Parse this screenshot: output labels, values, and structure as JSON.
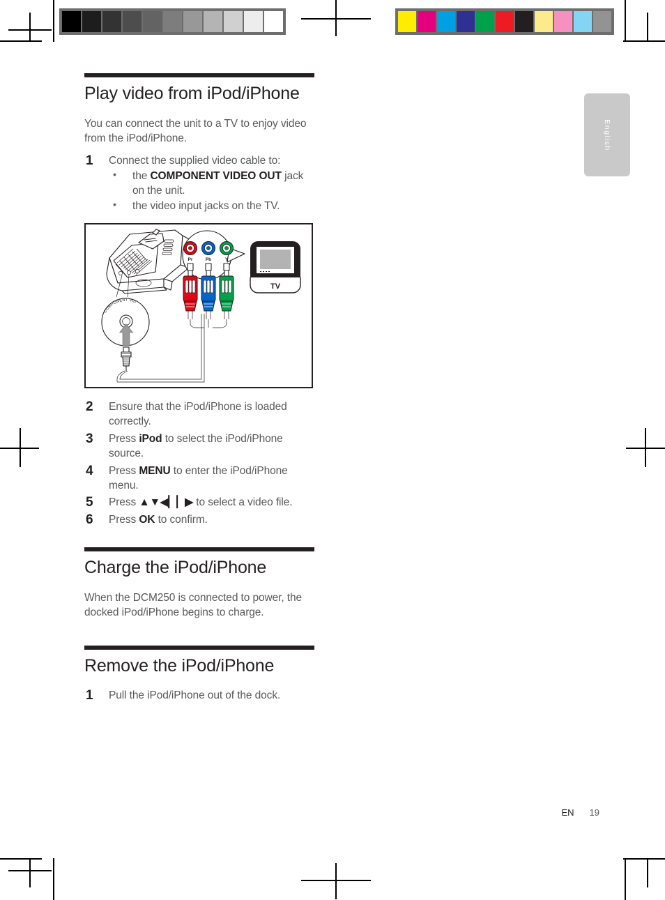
{
  "document": {
    "language_tab": "English",
    "footer": {
      "language_code": "EN",
      "page_number": "19"
    }
  },
  "calibration": {
    "grayscale_label": "grayscale-calibration-bar",
    "grayscale_swatches": [
      "#000000",
      "#1d1d1d",
      "#333333",
      "#4d4d4d",
      "#636363",
      "#7d7d7d",
      "#989898",
      "#b4b4b4",
      "#d0d0d0",
      "#ededed",
      "#ffffff"
    ],
    "color_label": "color-calibration-bar",
    "color_swatches": [
      "#ffed00",
      "#e5007d",
      "#00a0e3",
      "#2e3192",
      "#00a14b",
      "#ed1c24",
      "#231f20",
      "#fbeb8d",
      "#f690c0",
      "#84d5f3",
      "#939393"
    ]
  },
  "sections": [
    {
      "id": "play-video",
      "title": "Play video from iPod/iPhone",
      "intro": "You can connect the unit to a TV to enjoy video from the iPod/iPhone.",
      "steps": [
        {
          "num": "1",
          "text": "Connect the supplied video cable to:",
          "bullets": [
            {
              "prefix": "the ",
              "bold": "COMPONENT VIDEO OUT",
              "suffix": " jack on the unit."
            },
            {
              "prefix": "the video input jacks on the TV.",
              "bold": "",
              "suffix": ""
            }
          ]
        },
        {
          "num": "2",
          "prefix": "Ensure that the iPod/iPhone is loaded correctly.",
          "bold": "",
          "suffix": ""
        },
        {
          "num": "3",
          "prefix": "Press ",
          "bold": "iPod",
          "suffix": " to select the iPod/iPhone source."
        },
        {
          "num": "4",
          "prefix": "Press ",
          "bold": "MENU",
          "suffix": " to enter the iPod/iPhone menu."
        },
        {
          "num": "5",
          "prefix": "Press ",
          "bold": "▲▼◀▏▏▶",
          "suffix": " to select a video file."
        },
        {
          "num": "6",
          "prefix": "Press ",
          "bold": "OK",
          "suffix": " to confirm."
        }
      ]
    },
    {
      "id": "charge",
      "title": "Charge the iPod/iPhone",
      "intro": "When the DCM250 is connected to power, the docked iPod/iPhone begins to charge."
    },
    {
      "id": "remove",
      "title": "Remove the iPod/iPhone",
      "steps": [
        {
          "num": "1",
          "prefix": "Pull the iPod/iPhone out of the dock.",
          "bold": "",
          "suffix": ""
        }
      ]
    }
  ],
  "figure": {
    "name": "component-video-connection-diagram",
    "magnifier_label": "COMPONENT VIDEO OUT",
    "tv_label": "TV",
    "connectors": [
      {
        "label": "Pr",
        "color": "#e30613"
      },
      {
        "label": "Pb",
        "color": "#0066cc"
      },
      {
        "label": "Y",
        "color": "#00a14b"
      }
    ]
  }
}
